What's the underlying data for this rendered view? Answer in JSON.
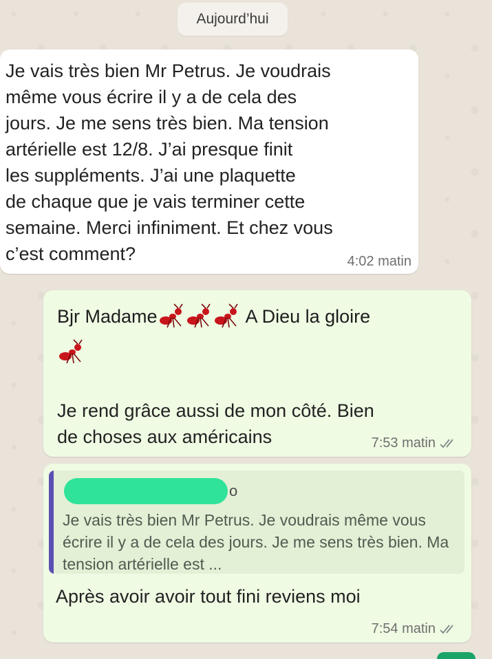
{
  "chat": {
    "date_label": "Aujourd’hui",
    "incoming": {
      "text": "Je vais très bien Mr Petrus. Je voudrais\nmême vous écrire il y a de cela des\njours. Je me sens très bien. Ma tension\nartérielle est 12/8. J’ai presque finit\nles suppléments. J’ai une plaquette\nde chaque que je vais terminer cette\nsemaine. Merci infiniment. Et chez vous\nc’est comment?",
      "time": "4:02 matin"
    },
    "outgoing_1": {
      "prefix": "Bjr Madame",
      "suffix": "A Dieu la gloire",
      "emoji_name": "ant-icon",
      "text": "Je rend grâce aussi de mon côté.  Bien\nde choses aux américains",
      "time": "7:53 matin",
      "status_icon": "double-check-icon"
    },
    "outgoing_2": {
      "quote": {
        "sender_suffix": "o",
        "text": "Je vais très bien Mr Petrus. Je voudrais même vous écrire il y a de cela des jours. Je me sens très bien. Ma tension artérielle est ..."
      },
      "text": "Après avoir avoir tout fini reviens moi",
      "time": "7:54 matin",
      "status_icon": "double-check-icon"
    }
  },
  "colors": {
    "incoming_bg": "#ffffff",
    "outgoing_bg": "#effbe3",
    "quote_bar": "#5b4fb3",
    "redaction": "#2fe39a"
  }
}
